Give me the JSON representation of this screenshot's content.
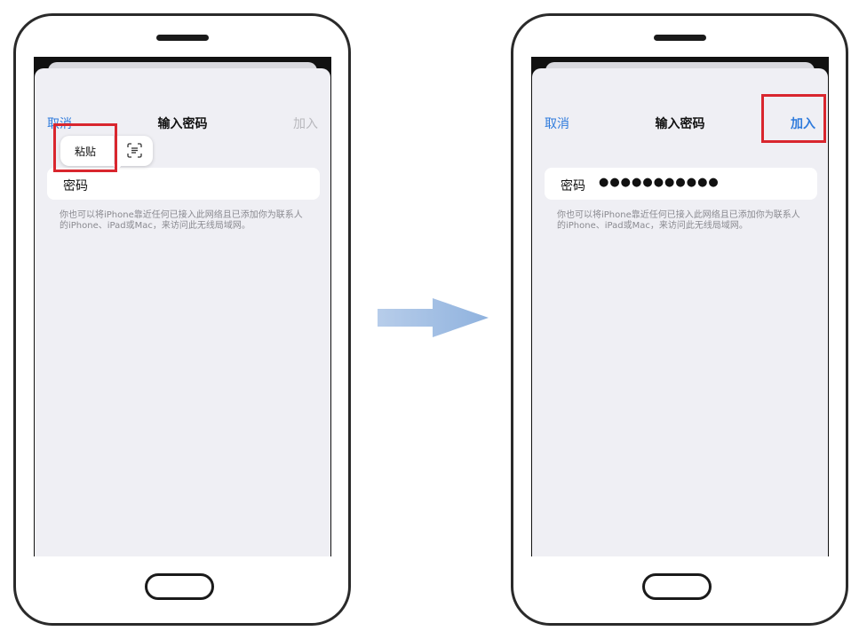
{
  "left_phone": {
    "nav": {
      "cancel": "取消",
      "title": "输入密码",
      "join": "加入"
    },
    "callout": {
      "paste": "粘贴",
      "scan_icon": "text-scan-icon"
    },
    "field": {
      "label": "密码",
      "value": ""
    },
    "note": "你也可以将iPhone靠近任何已接入此网络且已添加你为联系人的iPhone、iPad或Mac，来访问此无线局域网。"
  },
  "right_phone": {
    "nav": {
      "cancel": "取消",
      "title": "输入密码",
      "join": "加入"
    },
    "field": {
      "label": "密码",
      "value": "●●●●●●●●●●●"
    },
    "note": "你也可以将iPhone靠近任何已接入此网络且已添加你为联系人的iPhone、iPad或Mac，来访问此无线局域网。"
  },
  "colors": {
    "accent": "#2f7bdc",
    "highlight": "#d9262e",
    "disabled": "#b8b8bd",
    "arrow": "#9fbde2"
  }
}
